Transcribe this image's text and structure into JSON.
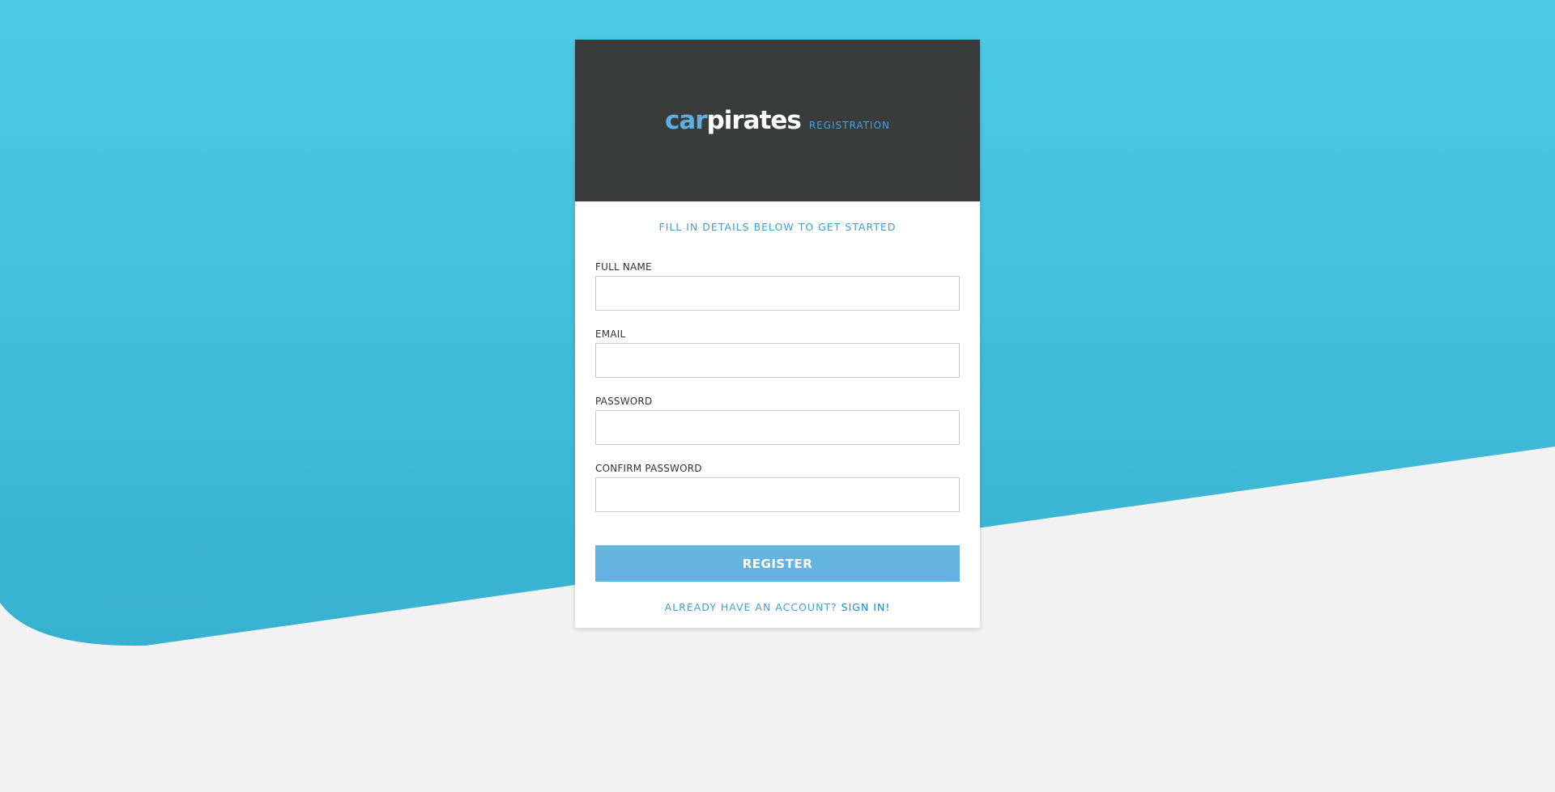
{
  "brand": {
    "logo_part1": "car",
    "logo_part2": "pirates",
    "subtitle": "REGISTRATION"
  },
  "form": {
    "intro": "FILL IN DETAILS BELOW TO GET STARTED",
    "fields": [
      {
        "label": "FULL NAME",
        "value": "",
        "placeholder": ""
      },
      {
        "label": "EMAIL",
        "value": "",
        "placeholder": ""
      },
      {
        "label": "PASSWORD",
        "value": "",
        "placeholder": ""
      },
      {
        "label": "CONFIRM PASSWORD",
        "value": "",
        "placeholder": ""
      }
    ],
    "submit_label": "REGISTER",
    "signin_prompt": "ALREADY HAVE AN ACCOUNT? ",
    "signin_link": "SIGN IN!"
  },
  "colors": {
    "background_top": "#4ecbe6",
    "background_bottom": "#38b0cf",
    "page_bg": "#f2f2f2",
    "header_bg": "#3a3b3b",
    "accent": "#3e9fd4",
    "button_bg": "#63b4e0"
  }
}
